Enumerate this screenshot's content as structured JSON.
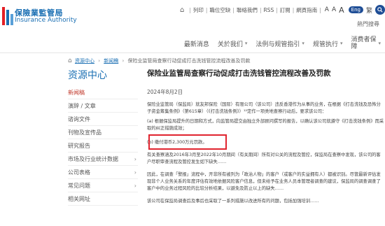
{
  "header": {
    "logo_zh": "保險業監管局",
    "logo_en": "Insurance Authority",
    "topbar_items": [
      "列印",
      "職位空缺",
      "聯絡我們",
      "RSS",
      "訂閱",
      "網頁指南"
    ],
    "font_small": "A",
    "font_mid": "A",
    "font_big": "A",
    "lang_en": "Eng",
    "lang_sc": "繁",
    "hot_search": "熱門搜尋"
  },
  "nav": {
    "items": [
      {
        "label": "最新消息"
      },
      {
        "label": "关於我们"
      },
      {
        "label": "法例与规管指引"
      },
      {
        "label": "规管执行"
      },
      {
        "label_line1": "消费者保",
        "label_line2": "障"
      }
    ]
  },
  "breadcrumb": {
    "home": "资源中心",
    "level2": "新闻稿",
    "current": "保险业监管局查察行动促成打击洗钱管控流程改善及罚款"
  },
  "sidebar": {
    "title": "资源中心",
    "items": [
      {
        "label": "新闻稿",
        "active": true,
        "chevron": false
      },
      {
        "label": "演辞 / 文章",
        "active": false,
        "chevron": false
      },
      {
        "label": "谘询文件",
        "active": false,
        "chevron": false
      },
      {
        "label": "刊物及宣传品",
        "active": false,
        "chevron": false
      },
      {
        "label": "研究报告",
        "active": false,
        "chevron": false
      },
      {
        "label": "市场及行业统计数据",
        "active": false,
        "chevron": true
      },
      {
        "label": "公司表格",
        "active": false,
        "chevron": true
      },
      {
        "label": "常见问题",
        "active": false,
        "chevron": true
      },
      {
        "label": "相关网址",
        "active": false,
        "chevron": false
      }
    ]
  },
  "article": {
    "title": "保险业监管局查察行动促成打击洗钱管控流程改善及罚款",
    "date": "2024年8月2日",
    "p1": "保险业监管局（保监局）就友邦保险（国际）有限公司（该公司）违反香港作为从事的业务，在根据《打击洗钱及恐怖分子资金筹集条例》（第615章）（《打击洗钱条例》）¹²定作一项类地查察行动后，要求该公司：",
    "item_a": "(a) 根据保监局提升的日期和方式，向监管局提交由独立外部顾问撰写的报告，以确认该公司就遵守《打击洗钱条例》而采取的纠正措施成效；",
    "item_b": "(b) 缴付港币2,300万元罚款。",
    "p2": "有关查察涵及2016年3月至2022年10月期间（有关期间）所有对公关的流程及管控，保监局在查察中发现，该公司的客户尽职审查流程及管控发生如下缺失……",
    "p3": "因此，在调查「警报」流程中，开非所有被列为「政治人物」的客户（或客户的实益拥有人）都被识别。尽管最新评估发现非个人业务关系的年度评估有效地依据风险客户信息，但未给予在业务人员本管理者调查的建议，保监局的调查调查了客户中的业务过程风险的比较分析结果，以避免及防止以上的缺失……",
    "p4": "该公司在保监局调查后及事后也采取了一系列措施以改进所有的问题，包括加强培训……"
  }
}
